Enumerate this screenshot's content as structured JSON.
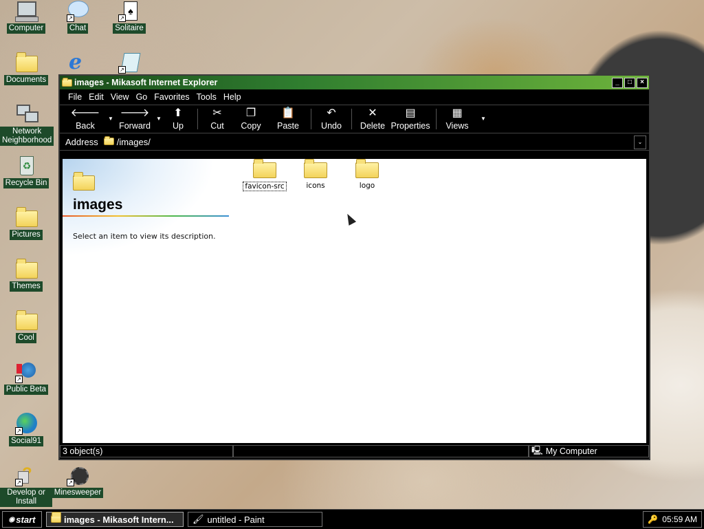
{
  "desktop": {
    "icons": [
      {
        "label": "Computer",
        "icon": "computer-icon"
      },
      {
        "label": "Chat",
        "icon": "chat-icon"
      },
      {
        "label": "Solitaire",
        "icon": "solitaire-icon"
      },
      {
        "label": "Documents",
        "icon": "documents-icon"
      },
      {
        "label": "Network Neighborhood",
        "icon": "network-icon"
      },
      {
        "label": "Recycle Bin",
        "icon": "recycle-bin-icon"
      },
      {
        "label": "Pictures",
        "icon": "folder-icon"
      },
      {
        "label": "Themes",
        "icon": "folder-icon"
      },
      {
        "label": "Cool",
        "icon": "folder-icon"
      },
      {
        "label": "Public Beta",
        "icon": "public-beta-icon"
      },
      {
        "label": "Social91",
        "icon": "globe-icon"
      },
      {
        "label": "Develop or Install",
        "icon": "develop-icon"
      },
      {
        "label": "Minesweeper",
        "icon": "minesweeper-icon"
      }
    ]
  },
  "window": {
    "title": "images - Mikasoft Internet Explorer",
    "controls": {
      "minimize": "_",
      "maximize": "□",
      "close": "×"
    },
    "menu": [
      "File",
      "Edit",
      "View",
      "Go",
      "Favorites",
      "Tools",
      "Help"
    ],
    "toolbar": {
      "back": "Back",
      "forward": "Forward",
      "up": "Up",
      "cut": "Cut",
      "copy": "Copy",
      "paste": "Paste",
      "undo": "Undo",
      "delete": "Delete",
      "properties": "Properties",
      "views": "Views"
    },
    "address": {
      "label": "Address",
      "value": "/images/"
    },
    "sidebar": {
      "title": "images",
      "description": "Select an item to view its description."
    },
    "items": [
      {
        "name": "favicon-src",
        "selected": true
      },
      {
        "name": "icons",
        "selected": false
      },
      {
        "name": "logo",
        "selected": false
      }
    ],
    "status": {
      "objects": "3 object(s)",
      "zone": "My Computer"
    }
  },
  "taskbar": {
    "start": "start",
    "tasks": [
      {
        "label": "images - Mikasoft Intern...",
        "active": true
      },
      {
        "label": "untitled - Paint",
        "active": false
      }
    ],
    "clock": "05:59 AM"
  },
  "colors": {
    "titlebar_start": "#1a4a1a",
    "titlebar_end": "#6db33b",
    "icon_label_bg": "#1d4a2a"
  }
}
